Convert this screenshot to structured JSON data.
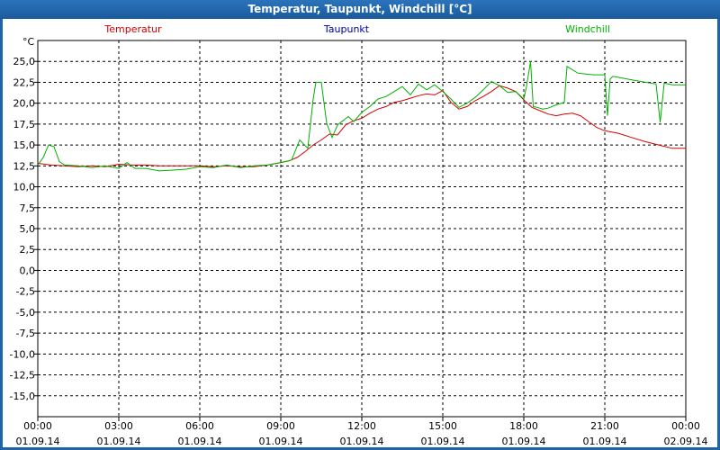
{
  "window": {
    "title": "Temperatur, Taupunkt, Windchill [°C]"
  },
  "chart_data": {
    "type": "line",
    "title": "Temperatur, Taupunkt, Windchill [°C]",
    "unit_label": "°C",
    "xlabel": "",
    "ylabel": "°C",
    "ylim": [
      -17.5,
      27.5
    ],
    "y_ticks": [
      "25,0",
      "22,5",
      "20,0",
      "17,5",
      "15,0",
      "12,5",
      "10,0",
      "7,5",
      "5,0",
      "2,5",
      "0,0",
      "-2,5",
      "-5,0",
      "-7,5",
      "-10,0",
      "-12,5",
      "-15,0"
    ],
    "y_tick_values": [
      25,
      22.5,
      20,
      17.5,
      15,
      12.5,
      10,
      7.5,
      5,
      2.5,
      0,
      -2.5,
      -5,
      -7.5,
      -10,
      -12.5,
      -15
    ],
    "xlim": [
      0,
      24
    ],
    "x_ticks": [
      {
        "time": "00:00",
        "date": "01.09.14"
      },
      {
        "time": "03:00",
        "date": "01.09.14"
      },
      {
        "time": "06:00",
        "date": "01.09.14"
      },
      {
        "time": "09:00",
        "date": "01.09.14"
      },
      {
        "time": "12:00",
        "date": "01.09.14"
      },
      {
        "time": "15:00",
        "date": "01.09.14"
      },
      {
        "time": "18:00",
        "date": "01.09.14"
      },
      {
        "time": "21:00",
        "date": "01.09.14"
      },
      {
        "time": "00:00",
        "date": "02.09.14"
      }
    ],
    "grid": true,
    "legend": [
      {
        "name": "Temperatur",
        "color": "#d40000"
      },
      {
        "name": "Taupunkt",
        "color": "#0000a0"
      },
      {
        "name": "Windchill",
        "color": "#00b000"
      }
    ],
    "series": [
      {
        "name": "Temperatur",
        "color": "#d40000",
        "x": [
          0,
          0.5,
          1,
          1.5,
          2,
          2.5,
          3,
          3.5,
          4,
          4.5,
          5,
          5.5,
          6,
          6.5,
          7,
          7.5,
          8,
          8.5,
          9,
          9.3,
          9.6,
          9.9,
          10.2,
          10.5,
          10.8,
          11.1,
          11.4,
          11.7,
          12,
          12.3,
          12.6,
          12.9,
          13.2,
          13.5,
          13.8,
          14.1,
          14.4,
          14.7,
          15,
          15.3,
          15.6,
          15.9,
          16.2,
          16.5,
          16.8,
          17.1,
          17.4,
          17.7,
          18,
          18.3,
          18.6,
          18.9,
          19.2,
          19.5,
          19.8,
          20.1,
          20.4,
          20.7,
          21,
          21.5,
          22,
          22.5,
          23,
          23.5,
          24
        ],
        "y": [
          12.8,
          12.6,
          12.5,
          12.4,
          12.5,
          12.4,
          12.7,
          12.6,
          12.6,
          12.5,
          12.5,
          12.5,
          12.5,
          12.4,
          12.5,
          12.4,
          12.4,
          12.6,
          12.9,
          13.1,
          13.5,
          14.2,
          15,
          15.6,
          16.3,
          16.2,
          17.4,
          17.9,
          18.2,
          18.8,
          19.3,
          19.6,
          20.1,
          20.3,
          20.6,
          20.9,
          21.1,
          21,
          21.5,
          20.1,
          19.3,
          19.6,
          20.3,
          20.8,
          21.4,
          22.1,
          21.8,
          21.4,
          20.4,
          19.5,
          19.1,
          18.7,
          18.5,
          18.7,
          18.8,
          18.5,
          17.8,
          17.1,
          16.7,
          16.4,
          15.9,
          15.4,
          15,
          14.6,
          14.6
        ]
      },
      {
        "name": "Windchill",
        "color": "#00b000",
        "x": [
          0,
          0.2,
          0.4,
          0.6,
          0.8,
          1,
          1.5,
          2,
          2.5,
          3,
          3.3,
          3.6,
          4,
          4.5,
          5,
          5.5,
          6,
          6.5,
          7,
          7.5,
          8,
          8.5,
          9,
          9.4,
          9.7,
          10,
          10.2,
          10.3,
          10.5,
          10.7,
          10.9,
          11.1,
          11.3,
          11.5,
          11.7,
          12,
          12.3,
          12.6,
          12.9,
          13.2,
          13.5,
          13.8,
          14.1,
          14.4,
          14.7,
          15,
          15.3,
          15.6,
          15.9,
          16.2,
          16.5,
          16.8,
          17.1,
          17.4,
          17.7,
          18,
          18.1,
          18.25,
          18.35,
          18.5,
          18.7,
          18.9,
          19.2,
          19.5,
          19.6,
          19.8,
          20,
          20.3,
          20.6,
          21,
          21.1,
          21.2,
          21.3,
          21.5,
          22,
          22.5,
          22.9,
          23.05,
          23.2,
          23.5,
          24
        ],
        "y": [
          12.6,
          13.5,
          15,
          14.8,
          13,
          12.6,
          12.5,
          12.3,
          12.5,
          12.2,
          12.9,
          12.2,
          12.2,
          11.9,
          12,
          12.1,
          12.4,
          12.3,
          12.6,
          12.3,
          12.5,
          12.6,
          12.9,
          13.2,
          15.6,
          14.6,
          20.5,
          22.5,
          22.5,
          17.6,
          15.9,
          17.4,
          17.9,
          18.4,
          17.8,
          18.9,
          19.6,
          20.5,
          20.8,
          21.4,
          22,
          21,
          22.3,
          21.6,
          22.2,
          21.4,
          20.5,
          19.5,
          20,
          20.7,
          21.6,
          22.6,
          22.1,
          21.3,
          21.4,
          20.5,
          22,
          25,
          19.6,
          19.5,
          19.3,
          19.4,
          19.8,
          20.1,
          24.4,
          24,
          23.6,
          23.5,
          23.4,
          23.4,
          18.5,
          22.9,
          23.2,
          23.1,
          22.8,
          22.5,
          22.3,
          17.7,
          22.4,
          22.2,
          22.2
        ]
      }
    ]
  }
}
